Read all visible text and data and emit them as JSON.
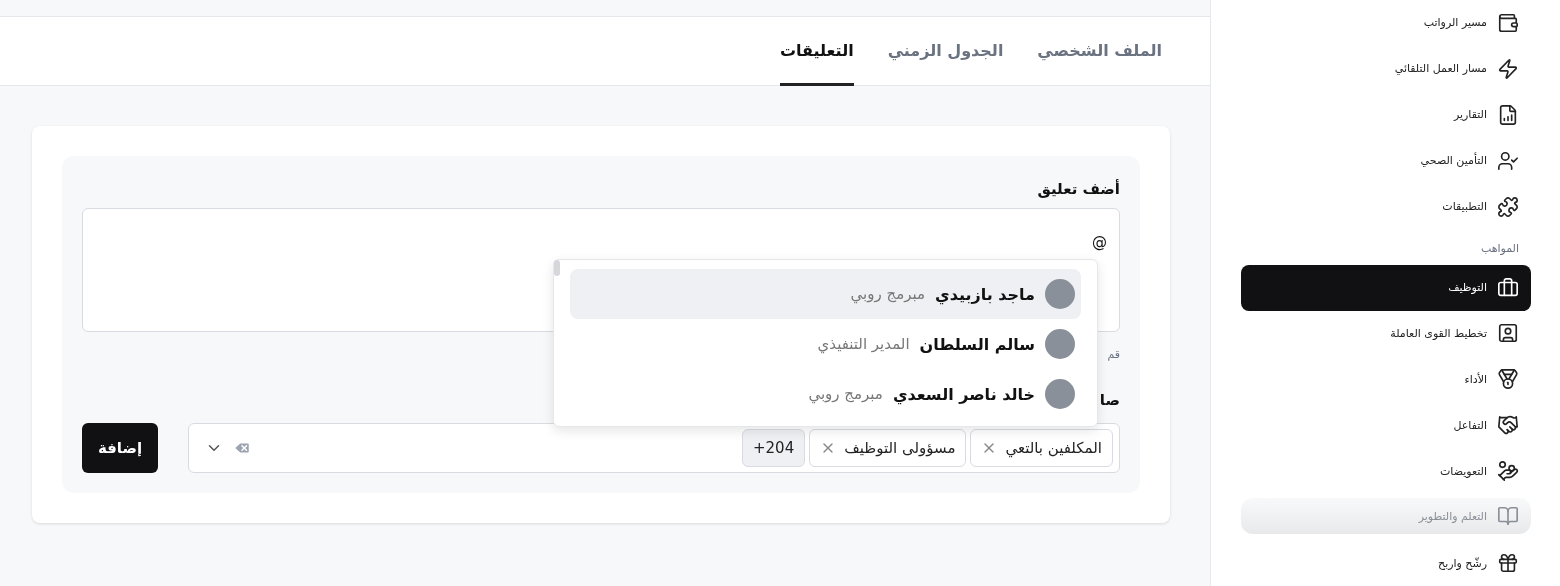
{
  "tabs": [
    {
      "label": "الملف الشخصي",
      "selected": false
    },
    {
      "label": "الجدول الزمني",
      "selected": false
    },
    {
      "label": "التعليقات",
      "selected": true
    }
  ],
  "comment_form": {
    "title": "أضف تعليق",
    "value": "@",
    "hint": "قم",
    "recipients_label": "صا",
    "mentions": [
      {
        "name": "ماجد بازبيدي",
        "role": "مبرمج روبي",
        "selected": true
      },
      {
        "name": "سالم السلطان",
        "role": "المدير التنفيذي",
        "selected": false
      },
      {
        "name": "خالد ناصر السعدي",
        "role": "مبرمج روبي",
        "selected": false
      }
    ],
    "chips": [
      {
        "label": "المكلفين بالتعي",
        "removable": true
      },
      {
        "label": "مسؤولى التوظيف",
        "removable": true
      },
      {
        "label": "+204",
        "removable": false
      }
    ],
    "submit": "إضافة"
  },
  "sidebar": {
    "items": [
      {
        "kind": "item",
        "label": "مسير الرواتب",
        "selected": false
      },
      {
        "kind": "item",
        "label": "مسار العمل التلقائي",
        "selected": false
      },
      {
        "kind": "item",
        "label": "التقارير",
        "selected": false
      },
      {
        "kind": "item",
        "label": "التأمين الصحي",
        "selected": false
      },
      {
        "kind": "item",
        "label": "التطبيقات",
        "selected": false
      },
      {
        "kind": "section",
        "label": "المواهب"
      },
      {
        "kind": "item",
        "label": "التوظيف",
        "selected": true
      },
      {
        "kind": "item",
        "label": "تخطيط القوى العاملة",
        "selected": false
      },
      {
        "kind": "item",
        "label": "الأداء",
        "selected": false
      },
      {
        "kind": "item",
        "label": "التفاعل",
        "selected": false
      },
      {
        "kind": "item",
        "label": "التعويضات",
        "selected": false
      },
      {
        "kind": "ghost",
        "label": "التعلم والتطوير"
      },
      {
        "kind": "item",
        "label": "رشّح واربح",
        "selected": false
      }
    ]
  }
}
